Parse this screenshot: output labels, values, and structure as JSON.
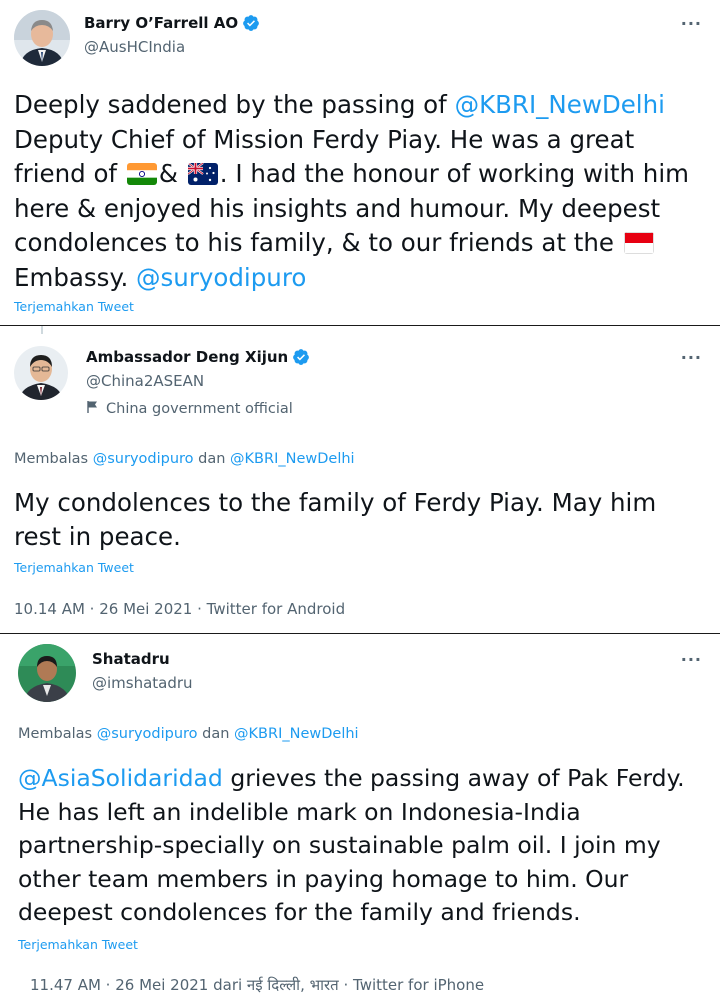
{
  "tweet1": {
    "author_name": "Barry O’Farrell AO",
    "author_handle": "@AusHCIndia",
    "text_part1": "Deeply saddened by the passing of ",
    "mention1": "@KBRI_NewDelhi",
    "text_part2": " Deputy Chief of Mission Ferdy Piay. He was a great friend of ",
    "text_part3": "& ",
    "text_part4": ". I had the honour of working with him here & enjoyed his insights and humour. My deepest condolences to his family, & to our friends at the ",
    "text_part5": "Embassy. ",
    "mention2": "@suryodipuro",
    "translate": "Terjemahkan Tweet",
    "flags": [
      "india-flag",
      "australia-flag",
      "indonesia-flag"
    ]
  },
  "tweet2": {
    "author_name": "Ambassador Deng Xijun",
    "author_handle": "@China2ASEAN",
    "gov_label": "China government official",
    "reply_prefix": "Membalas ",
    "reply_mention1": "@suryodipuro",
    "reply_and": " dan ",
    "reply_mention2": "@KBRI_NewDelhi",
    "text": "My condolences to the family of Ferdy Piay. May him rest in peace.",
    "translate": "Terjemahkan Tweet",
    "meta": "10.14 AM · 26 Mei 2021 · Twitter for Android"
  },
  "tweet3": {
    "author_name": "Shatadru",
    "author_handle": "@imshatadru",
    "reply_prefix": "Membalas ",
    "reply_mention1": "@suryodipuro",
    "reply_and": " dan ",
    "reply_mention2": "@KBRI_NewDelhi",
    "mention": "@AsiaSolidaridad",
    "text": " grieves the passing away of Pak Ferdy. He has left an indelible mark on Indonesia-India partnership-specially on sustainable palm oil. I join my other team members in paying homage to him. Our deepest condolences for the family and friends.",
    "translate": "Terjemahkan Tweet",
    "meta": "11.47 AM · 26 Mei 2021 dari नई दिल्ली, भारत · Twitter for iPhone"
  },
  "more_label": "···",
  "colors": {
    "link": "#1d9bf0",
    "muted": "#536471",
    "text": "#0f1419",
    "verified": "#1d9bf0"
  }
}
